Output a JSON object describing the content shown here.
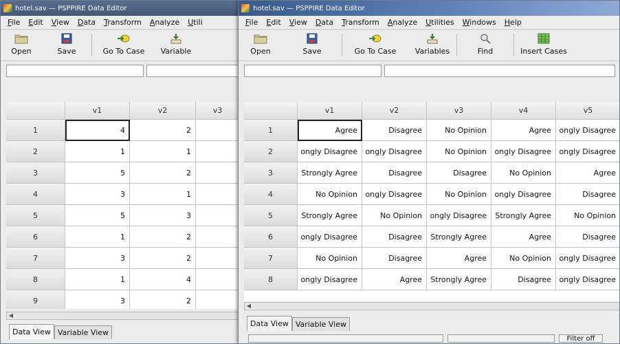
{
  "left_window": {
    "title": "hotel.sav — PSPPIRE Data Editor",
    "menu": [
      "File",
      "Edit",
      "View",
      "Data",
      "Transform",
      "Analyze",
      "Utili"
    ],
    "toolbar": [
      {
        "label": "Open",
        "icon": "folder-icon"
      },
      {
        "label": "Save",
        "icon": "floppy-disk-icon"
      },
      {
        "label": "Go To Case",
        "icon": "go-to-case-icon"
      },
      {
        "label": "Variable",
        "icon": "variables-icon"
      }
    ],
    "columns": [
      "v1",
      "v2",
      "v3"
    ],
    "rows": [
      {
        "num": "1",
        "cells": [
          "4",
          "2",
          ""
        ]
      },
      {
        "num": "2",
        "cells": [
          "1",
          "1",
          ""
        ]
      },
      {
        "num": "3",
        "cells": [
          "5",
          "2",
          ""
        ]
      },
      {
        "num": "4",
        "cells": [
          "3",
          "1",
          ""
        ]
      },
      {
        "num": "5",
        "cells": [
          "5",
          "3",
          ""
        ]
      },
      {
        "num": "6",
        "cells": [
          "1",
          "2",
          ""
        ]
      },
      {
        "num": "7",
        "cells": [
          "3",
          "2",
          ""
        ]
      },
      {
        "num": "8",
        "cells": [
          "1",
          "4",
          ""
        ]
      },
      {
        "num": "9",
        "cells": [
          "3",
          "2",
          ""
        ]
      }
    ],
    "tabs": [
      "Data View",
      "Variable View"
    ]
  },
  "right_window": {
    "title": "hotel.sav — PSPPIRE Data Editor",
    "menu": [
      "File",
      "Edit",
      "View",
      "Data",
      "Transform",
      "Analyze",
      "Utilities",
      "Windows",
      "Help"
    ],
    "toolbar": [
      {
        "label": "Open",
        "icon": "folder-icon"
      },
      {
        "label": "Save",
        "icon": "floppy-disk-icon"
      },
      {
        "label": "Go To Case",
        "icon": "go-to-case-icon"
      },
      {
        "label": "Variables",
        "icon": "variables-icon"
      },
      {
        "label": "Find",
        "icon": "magnifier-icon"
      },
      {
        "label": "Insert Cases",
        "icon": "insert-cases-icon"
      }
    ],
    "columns": [
      "v1",
      "v2",
      "v3",
      "v4",
      "v5"
    ],
    "rows": [
      {
        "num": "1",
        "cells": [
          "Agree",
          "Disagree",
          "No Opinion",
          "Agree",
          "ongly Disagree"
        ]
      },
      {
        "num": "2",
        "cells": [
          "ongly Disagree",
          "ongly Disagree",
          "No Opinion",
          "ongly Disagree",
          "ongly Disagree"
        ]
      },
      {
        "num": "3",
        "cells": [
          "Strongly Agree",
          "Disagree",
          "Disagree",
          "No Opinion",
          "Agree"
        ]
      },
      {
        "num": "4",
        "cells": [
          "No Opinion",
          "ongly Disagree",
          "No Opinion",
          "ongly Disagree",
          "Disagree"
        ]
      },
      {
        "num": "5",
        "cells": [
          "Strongly Agree",
          "No Opinion",
          "ongly Disagree",
          "Strongly Agree",
          "No Opinion"
        ]
      },
      {
        "num": "6",
        "cells": [
          "ongly Disagree",
          "Disagree",
          "Strongly Agree",
          "Agree",
          "Disagree"
        ]
      },
      {
        "num": "7",
        "cells": [
          "No Opinion",
          "Disagree",
          "Agree",
          "No Opinion",
          "ongly Disagree"
        ]
      },
      {
        "num": "8",
        "cells": [
          "ongly Disagree",
          "Agree",
          "Strongly Agree",
          "Disagree",
          "ongly Disagree"
        ]
      }
    ],
    "tabs": [
      "Data View",
      "Variable View"
    ],
    "status_filter": "Filter off"
  }
}
